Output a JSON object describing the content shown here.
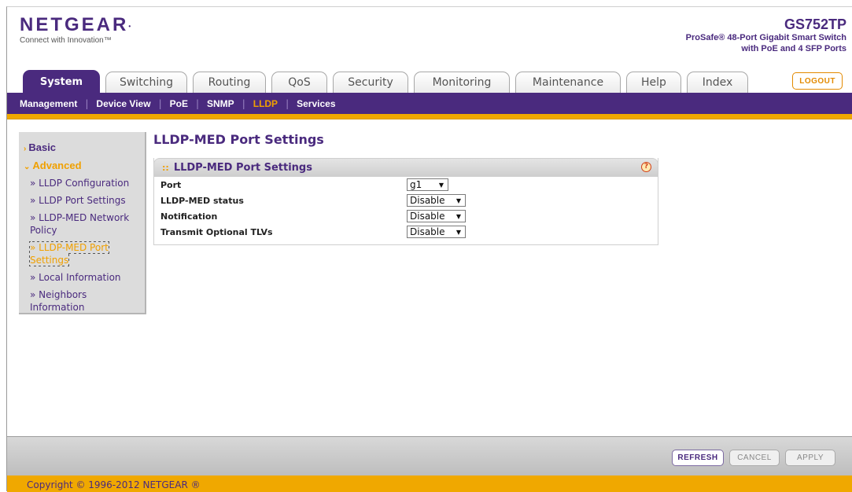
{
  "brand": {
    "logo": "NETGEAR",
    "tagline": "Connect with Innovation™",
    "model": "GS752TP",
    "model_desc_line1": "ProSafe® 48-Port Gigabit Smart Switch",
    "model_desc_line2": "with PoE and 4 SFP Ports"
  },
  "tabs": [
    {
      "label": "System",
      "active": true
    },
    {
      "label": "Switching"
    },
    {
      "label": "Routing"
    },
    {
      "label": "QoS"
    },
    {
      "label": "Security"
    },
    {
      "label": "Monitoring"
    },
    {
      "label": "Maintenance"
    },
    {
      "label": "Help"
    },
    {
      "label": "Index"
    }
  ],
  "logout_label": "LOGOUT",
  "subnav": [
    {
      "label": "Management"
    },
    {
      "label": "Device View"
    },
    {
      "label": "PoE"
    },
    {
      "label": "SNMP"
    },
    {
      "label": "LLDP",
      "active": true
    },
    {
      "label": "Services"
    }
  ],
  "sidebar": {
    "basic": "Basic",
    "advanced": "Advanced",
    "items": [
      "» LLDP Configuration",
      "» LLDP Port Settings",
      "» LLDP-MED Network Policy",
      "» LLDP-MED Port Settings",
      "» Local Information",
      "» Neighbors Information"
    ]
  },
  "main": {
    "page_title": "LLDP-MED Port Settings",
    "panel_title": "LLDP-MED Port Settings",
    "help_glyph": "?",
    "rows": [
      {
        "label": "Port",
        "value": "g1"
      },
      {
        "label": "LLDP-MED status",
        "value": "Disable"
      },
      {
        "label": "Notification",
        "value": "Disable"
      },
      {
        "label": "Transmit Optional TLVs",
        "value": "Disable"
      }
    ]
  },
  "buttons": {
    "refresh": "REFRESH",
    "cancel": "CANCEL",
    "apply": "APPLY"
  },
  "footer": "Copyright © 1996-2012 NETGEAR ®",
  "colors": {
    "brand_purple": "#4a2a7e",
    "accent_orange": "#f0a800"
  }
}
